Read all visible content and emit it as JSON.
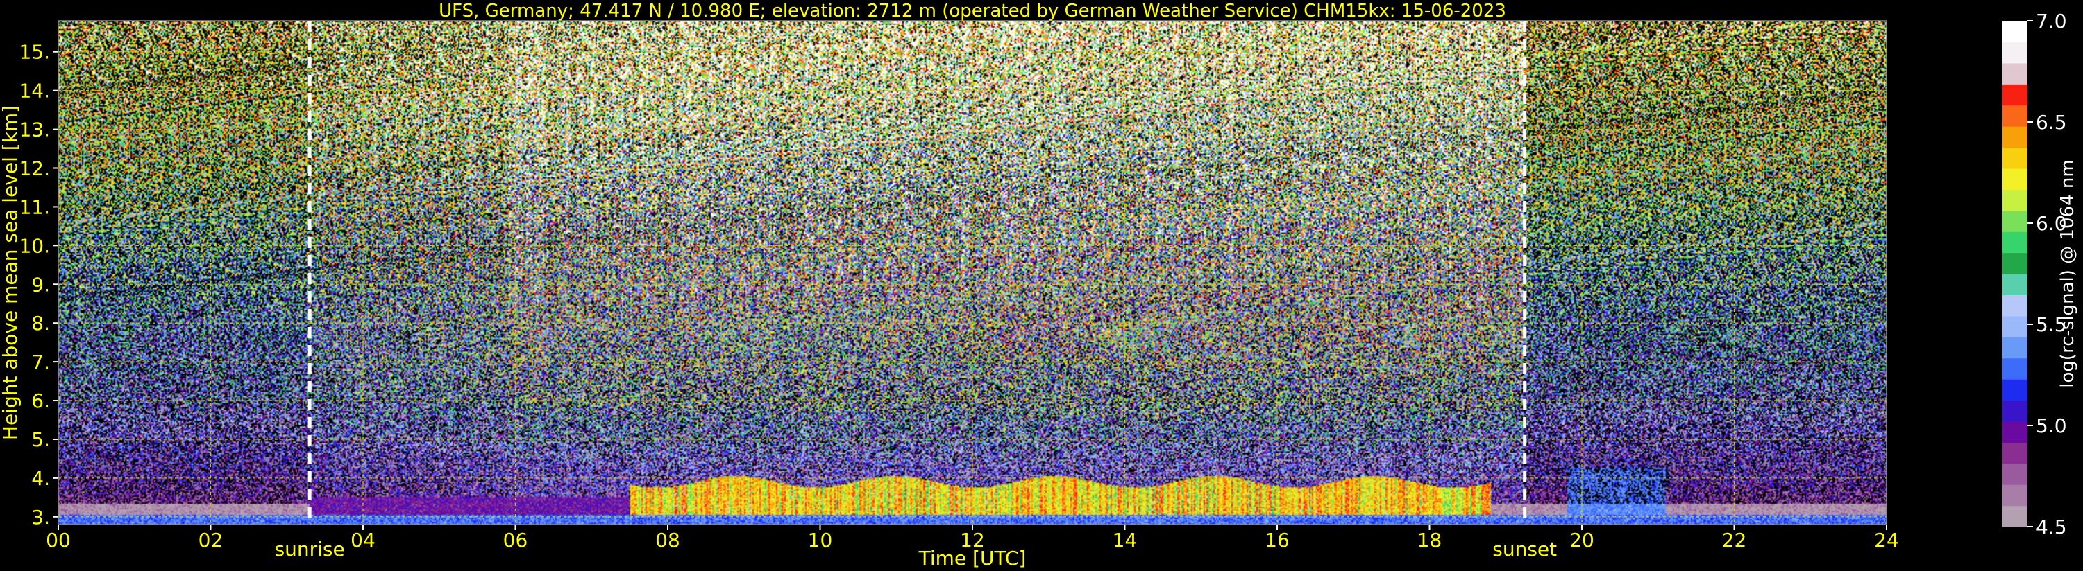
{
  "chart_data": {
    "type": "heatmap",
    "title": "UFS, Germany; 47.417 N / 10.980 E; elevation: 2712 m  (operated by German Weather Service)    CHM15kx: 15-06-2023",
    "xlabel": "Time [UTC]",
    "ylabel": "Height above mean sea level [km]",
    "xlim": [
      0,
      24
    ],
    "ylim": [
      2.8,
      15.8
    ],
    "xticks": [
      "00",
      "02",
      "04",
      "06",
      "08",
      "10",
      "12",
      "14",
      "16",
      "18",
      "20",
      "22",
      "24"
    ],
    "yticks": [
      "3.",
      "4.",
      "5.",
      "6.",
      "7.",
      "8.",
      "9.",
      "10.",
      "11.",
      "12.",
      "13.",
      "14.",
      "15."
    ],
    "grid": true,
    "annotations": [
      {
        "label": "sunrise",
        "x": 3.3
      },
      {
        "label": "sunset",
        "x": 19.25
      }
    ],
    "colorbar": {
      "label": "log(rc-signal) @ 1064 nm",
      "range": [
        4.5,
        7.0
      ],
      "ticks": [
        "4.5",
        "5.0",
        "5.5",
        "6.0",
        "6.5",
        "7.0"
      ]
    },
    "value_description": "log10 range-corrected lidar backscatter signal as a function of time and height"
  },
  "colors": {
    "background": "#000000",
    "text": "#ffff00",
    "grid": "#c8c800",
    "annotation_line": "#ffffff",
    "colormap": [
      "#b3a0b0",
      "#a87ea8",
      "#9a5a9e",
      "#8a2e92",
      "#6a0aa0",
      "#3a14c8",
      "#1e2cf0",
      "#3c6cf8",
      "#6a9af8",
      "#9ab8fa",
      "#b6c8fa",
      "#5acfae",
      "#22a848",
      "#36d46a",
      "#7ae05a",
      "#c8f040",
      "#f4f028",
      "#f8d010",
      "#f8a008",
      "#f86818",
      "#f82010",
      "#e0c8d0",
      "#f4f0f4",
      "#ffffff"
    ]
  }
}
